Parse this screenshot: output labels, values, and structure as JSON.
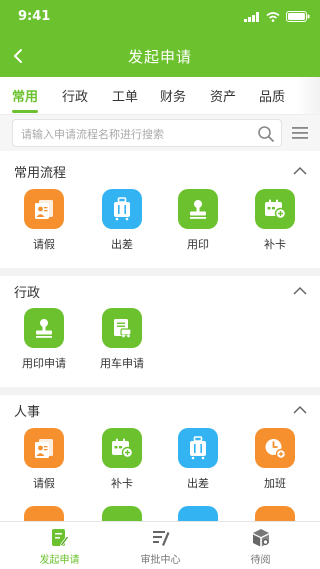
{
  "status": {
    "time": "9:41"
  },
  "nav": {
    "title": "发起申请"
  },
  "tabs": [
    "常用",
    "行政",
    "工单",
    "财务",
    "资产",
    "品质"
  ],
  "search": {
    "placeholder": "请输入申请流程名称进行搜索"
  },
  "sections": [
    {
      "title": "常用流程",
      "items": [
        {
          "label": "请假",
          "icon": "leave-icon",
          "color": "#f6902e"
        },
        {
          "label": "出差",
          "icon": "suitcase-icon",
          "color": "#33b3f2"
        },
        {
          "label": "用印",
          "icon": "stamp-icon",
          "color": "#6cc22e"
        },
        {
          "label": "补卡",
          "icon": "calendar-add-icon",
          "color": "#6cc22e"
        }
      ]
    },
    {
      "title": "行政",
      "items": [
        {
          "label": "用印申请",
          "icon": "stamp-icon",
          "color": "#6cc22e"
        },
        {
          "label": "用车申请",
          "icon": "car-form-icon",
          "color": "#6cc22e"
        }
      ]
    },
    {
      "title": "人事",
      "items": [
        {
          "label": "请假",
          "icon": "leave-icon",
          "color": "#f6902e"
        },
        {
          "label": "补卡",
          "icon": "calendar-add-icon",
          "color": "#6cc22e"
        },
        {
          "label": "出差",
          "icon": "suitcase-icon",
          "color": "#33b3f2"
        },
        {
          "label": "加班",
          "icon": "clock-add-icon",
          "color": "#f6902e"
        }
      ]
    }
  ],
  "bottom_nav": [
    {
      "label": "发起申请",
      "icon": "edit-form-icon",
      "active": true
    },
    {
      "label": "审批中心",
      "icon": "approval-list-icon",
      "active": false
    },
    {
      "label": "待阅",
      "icon": "read-box-icon",
      "active": false
    }
  ],
  "colors": {
    "primary": "#6cc22e",
    "blue": "#33b3f2",
    "orange": "#f6902e"
  }
}
